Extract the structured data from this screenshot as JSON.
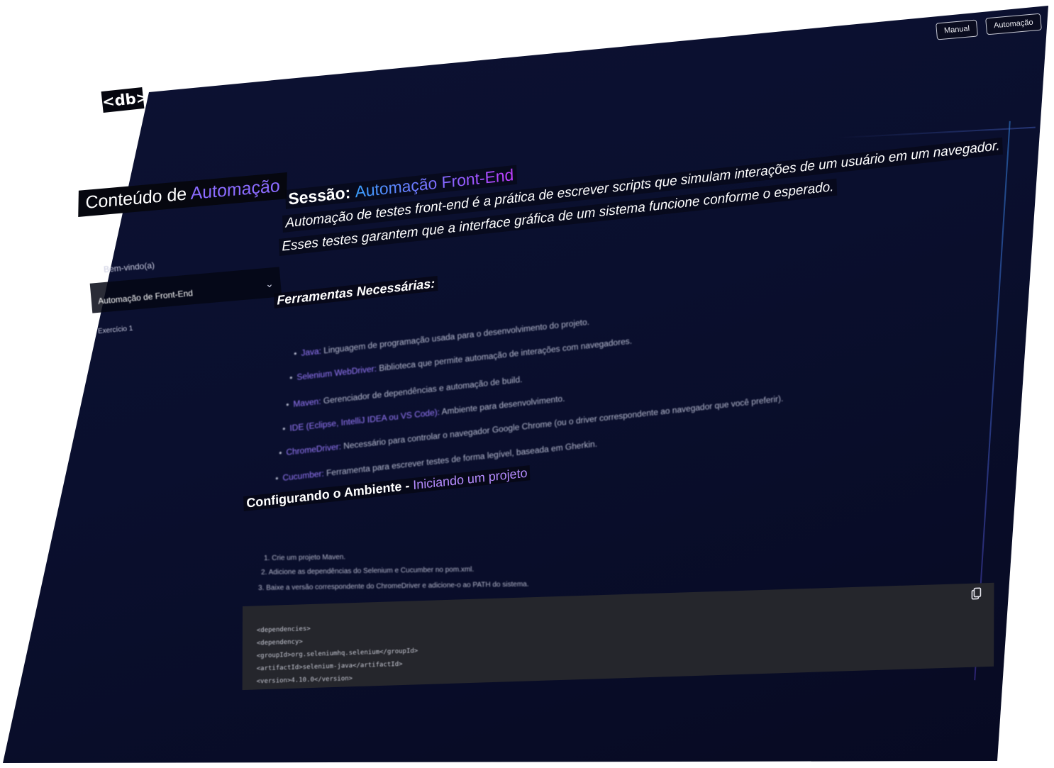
{
  "header": {
    "logo": "<db>",
    "buttons": [
      {
        "label": "Manual"
      },
      {
        "label": "Automação"
      }
    ]
  },
  "sidebar": {
    "title_prefix": "Conteúdo de ",
    "title_accent": "Automação",
    "items": [
      {
        "label": "Bem-vindo(a)"
      },
      {
        "label": "Automação de Front-End"
      },
      {
        "label": "Exercício 1"
      }
    ]
  },
  "main": {
    "session_label": "Sessão:",
    "session_name": "Automação Front-End",
    "description_lines": [
      "Automação de testes front-end é a prática de escrever scripts que simulam interações de um usuário em um navegador.",
      "Esses testes garantem que a interface gráfica de um sistema funcione conforme o esperado."
    ],
    "tools_title": "Ferramentas Necessárias:",
    "tools": [
      {
        "name": "Java:",
        "text": " Linguagem de programação usada para o desenvolvimento do projeto."
      },
      {
        "name": "Selenium WebDriver:",
        "text": " Biblioteca que permite automação de interações com navegadores."
      },
      {
        "name": "Maven:",
        "text": " Gerenciador de dependências e automação de build."
      },
      {
        "name": "IDE (Eclipse, IntelliJ IDEA ou VS Code):",
        "text": " Ambiente para desenvolvimento."
      },
      {
        "name": "ChromeDriver:",
        "text": " Necessário para controlar o navegador Google Chrome (ou o driver correspondente ao navegador que você preferir)."
      },
      {
        "name": "Cucumber:",
        "text": " Ferramenta para escrever testes de forma legível, baseada em Gherkin."
      }
    ],
    "config_title": "Configurando o Ambiente - ",
    "config_accent": "Iniciando um projeto",
    "steps": [
      "1. Crie um projeto Maven.",
      "2. Adicione as dependências do Selenium e Cucumber no pom.xml.",
      "3. Baixe a versão correspondente do ChromeDriver e adicione-o ao PATH do sistema."
    ],
    "code_lines": [
      "<dependencies>",
      "<dependency>",
      "  <groupId>org.seleniumhq.selenium</groupId>",
      "  <artifactId>selenium-java</artifactId>",
      "  <version>4.10.0</version>"
    ]
  }
}
